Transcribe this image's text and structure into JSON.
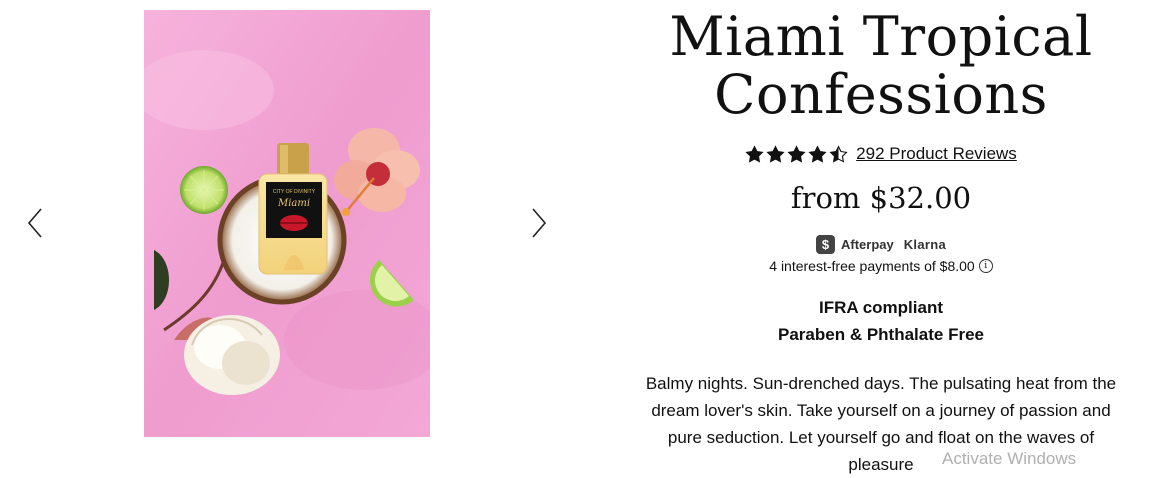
{
  "product": {
    "title_line1": "Miami Tropical",
    "title_line2": "Confessions",
    "rating": 4.5,
    "rating_max": 5,
    "reviews_label": "292 Product Reviews",
    "price": "from $32.00",
    "features": [
      "IFRA compliant",
      "Paraben & Phthalate Free"
    ],
    "description": "Balmy nights. Sun-drenched days. The pulsating heat from the dream lover's skin. Take yourself on a journey of passion and pure seduction. Let yourself go and float on the waves of pleasure"
  },
  "payments": {
    "afterpay_symbol": "$",
    "afterpay_label": "Afterpay",
    "klarna_label": "Klarna",
    "installments_text": "4 interest-free payments of $8.00",
    "info_symbol": "i"
  },
  "image": {
    "bottle_label_brand": "CITY OF DIVINITY",
    "bottle_label_name": "Miami"
  },
  "icons": {
    "prev": "chevron-left-icon",
    "next": "chevron-right-icon",
    "star": "star-icon"
  },
  "system": {
    "watermark": "Activate Windows"
  },
  "colors": {
    "background_pink": "#f2a6d2",
    "text": "#111111",
    "badge": "#444444"
  }
}
